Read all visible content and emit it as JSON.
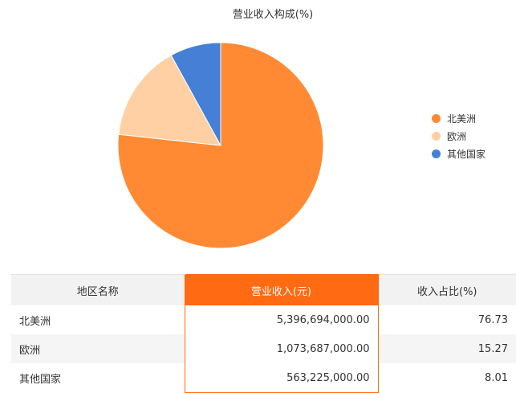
{
  "chart_data": {
    "type": "pie",
    "title": "营业收入构成(%)",
    "categories": [
      "北美洲",
      "欧洲",
      "其他国家"
    ],
    "values": [
      76.73,
      15.27,
      8.01
    ],
    "colors": [
      "#ff8a33",
      "#ffd0a3",
      "#4580d6"
    ],
    "legend_position": "right"
  },
  "table": {
    "headers": [
      "地区名称",
      "营业收入(元)",
      "收入占比(%)"
    ],
    "rows": [
      {
        "name": "北美洲",
        "revenue": "5,396,694,000.00",
        "share": "76.73"
      },
      {
        "name": "欧洲",
        "revenue": "1,073,687,000.00",
        "share": "15.27"
      },
      {
        "name": "其他国家",
        "revenue": "563,225,000.00",
        "share": "8.01"
      }
    ]
  }
}
